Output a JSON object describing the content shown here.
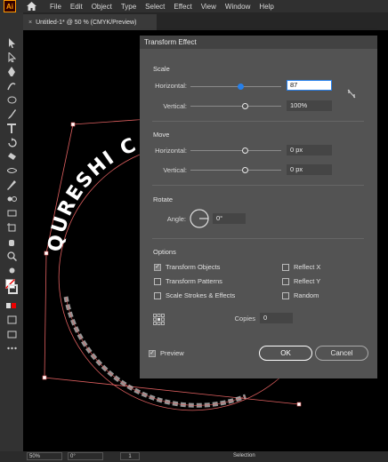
{
  "app": {
    "logo": "Ai",
    "home_icon": "home-icon"
  },
  "menu": [
    "File",
    "Edit",
    "Object",
    "Type",
    "Select",
    "Effect",
    "View",
    "Window",
    "Help"
  ],
  "document_tab": {
    "title": "Untitled-1* @ 50 % (CMYK/Preview)",
    "close": "×"
  },
  "canvas_art": {
    "text": "QURESHI C"
  },
  "status": {
    "zoom": "50%",
    "rotation": "0°",
    "page": "1",
    "mode": "Selection"
  },
  "dialog": {
    "title": "Transform Effect",
    "scale": {
      "section": "Scale",
      "horizontal_label": "Horizontal:",
      "horizontal_value": "87",
      "horizontal_level": 0.55,
      "vertical_label": "Vertical:",
      "vertical_value": "100%",
      "vertical_level": 0.6
    },
    "move": {
      "section": "Move",
      "horizontal_label": "Horizontal:",
      "horizontal_value": "0 px",
      "horizontal_level": 0.6,
      "vertical_label": "Vertical:",
      "vertical_value": "0 px",
      "vertical_level": 0.6
    },
    "rotate": {
      "section": "Rotate",
      "angle_label": "Angle:",
      "angle_value": "0°"
    },
    "options": {
      "section": "Options",
      "transform_objects": {
        "label": "Transform Objects",
        "checked": true
      },
      "transform_patterns": {
        "label": "Transform Patterns",
        "checked": false
      },
      "scale_strokes": {
        "label": "Scale Strokes & Effects",
        "checked": false
      },
      "reflect_x": {
        "label": "Reflect X",
        "checked": false
      },
      "reflect_y": {
        "label": "Reflect Y",
        "checked": false
      },
      "random": {
        "label": "Random",
        "checked": false
      }
    },
    "copies_label": "Copies",
    "copies_value": "0",
    "preview": {
      "label": "Preview",
      "checked": true
    },
    "ok_label": "OK",
    "cancel_label": "Cancel"
  }
}
